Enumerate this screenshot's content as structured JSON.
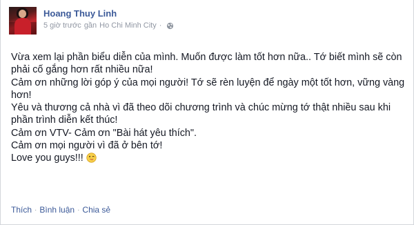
{
  "post": {
    "author": "Hoang Thuy Linh",
    "time": "5 giờ trước",
    "location_prefix": "gần",
    "location": "Ho Chi Minh City",
    "privacy_icon": "globe-icon",
    "lines": [
      "Vừa xem lại phần biểu diễn của mình. Muốn được làm tốt hơn nữa.. Tớ biết mình sẽ còn phải cố gắng hơn rất nhiều nữa!",
      "Cảm ơn những lời góp ý của mọi người! Tớ sẽ rèn luyện để ngày một tốt hơn, vững vàng hơn!",
      "Yêu và thương cả nhà vì đã theo dõi chương trình và chúc mừng tớ thật nhiều sau khi phần trình diễn kết thúc!",
      "Cảm ơn VTV- Cảm ơn \"Bài hát yêu thích\".",
      "Cảm ơn mọi người vì đã ở bên tớ!",
      "Love you guys!!!"
    ],
    "emoji_icon": "wink-emoji-icon"
  },
  "actions": {
    "like": "Thích",
    "comment": "Bình luận",
    "share": "Chia sẻ",
    "separator": "·"
  },
  "colors": {
    "link": "#3b5998",
    "text": "#141823",
    "meta": "#9197a3",
    "border": "#d3d6db"
  }
}
